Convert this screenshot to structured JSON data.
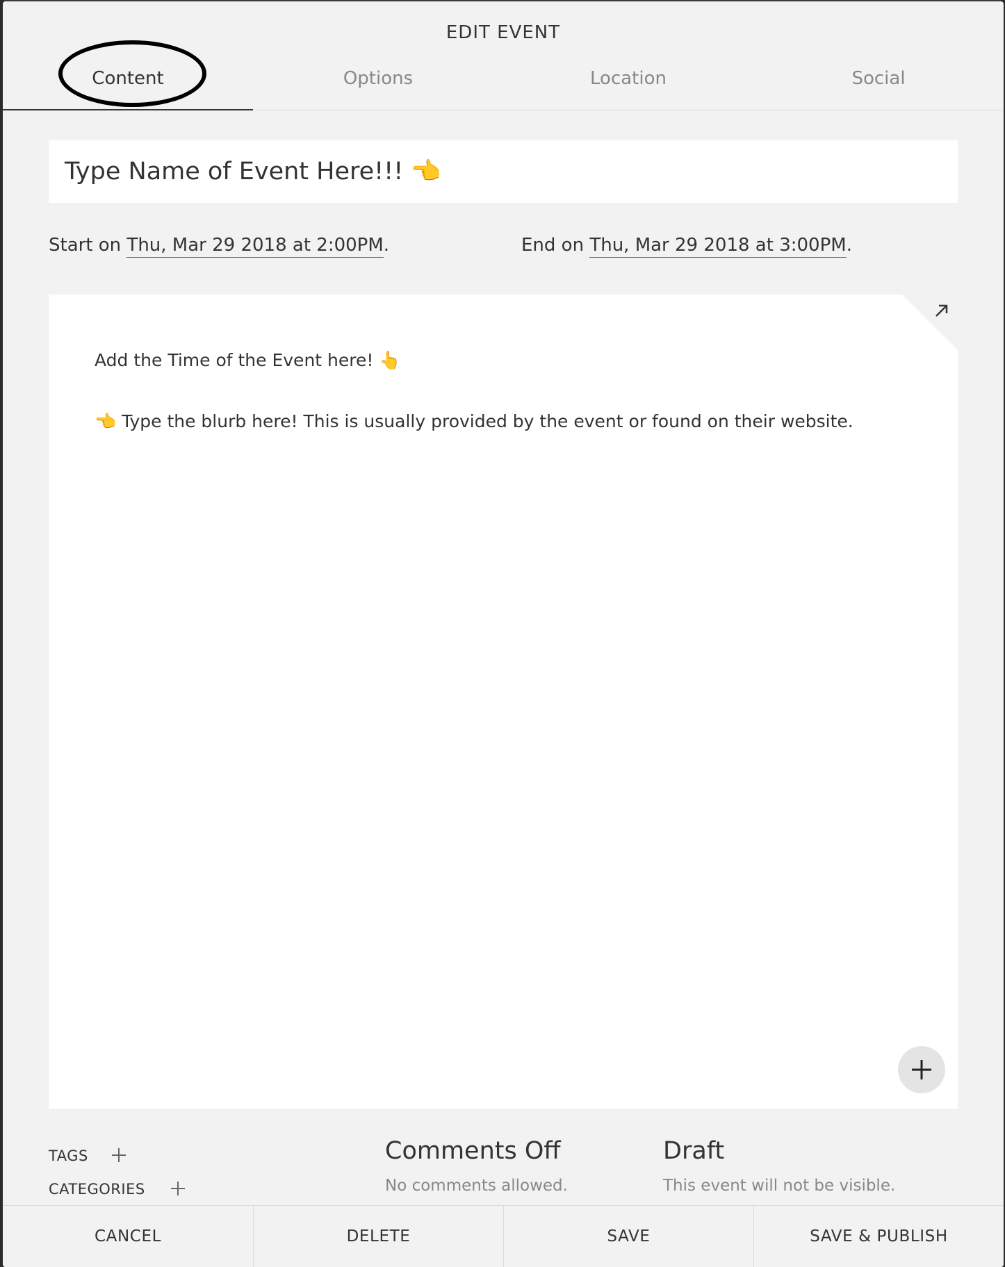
{
  "dialog": {
    "title": "EDIT EVENT"
  },
  "tabs": [
    {
      "label": "Content",
      "active": true
    },
    {
      "label": "Options",
      "active": false
    },
    {
      "label": "Location",
      "active": false
    },
    {
      "label": "Social",
      "active": false
    }
  ],
  "event": {
    "title_value": "Type Name of Event Here!!! 👈",
    "start_prefix": "Start on ",
    "start_datetime": "Thu, Mar 29 2018 at 2:00PM",
    "end_prefix": "End on ",
    "end_datetime": "Thu, Mar 29 2018 at 3:00PM",
    "period": "."
  },
  "editor": {
    "line1": "Add the Time of the Event here! 👆",
    "line2": "👈 Type the blurb here! This is usually provided by the event or found on their website.",
    "expand_icon": "expand-arrow-icon",
    "add_block_icon": "plus-icon"
  },
  "meta": {
    "tags_label": "TAGS",
    "categories_label": "CATEGORIES",
    "comments_title": "Comments Off",
    "comments_sub": "No comments allowed.",
    "status_title": "Draft",
    "status_sub": "This event will not be visible."
  },
  "footer": {
    "cancel": "CANCEL",
    "delete": "DELETE",
    "save": "SAVE",
    "save_publish": "SAVE & PUBLISH"
  },
  "colors": {
    "panel_bg": "#f2f2f2",
    "field_bg": "#ffffff",
    "text": "#333333",
    "muted": "#888888",
    "annotation": "#000000"
  }
}
